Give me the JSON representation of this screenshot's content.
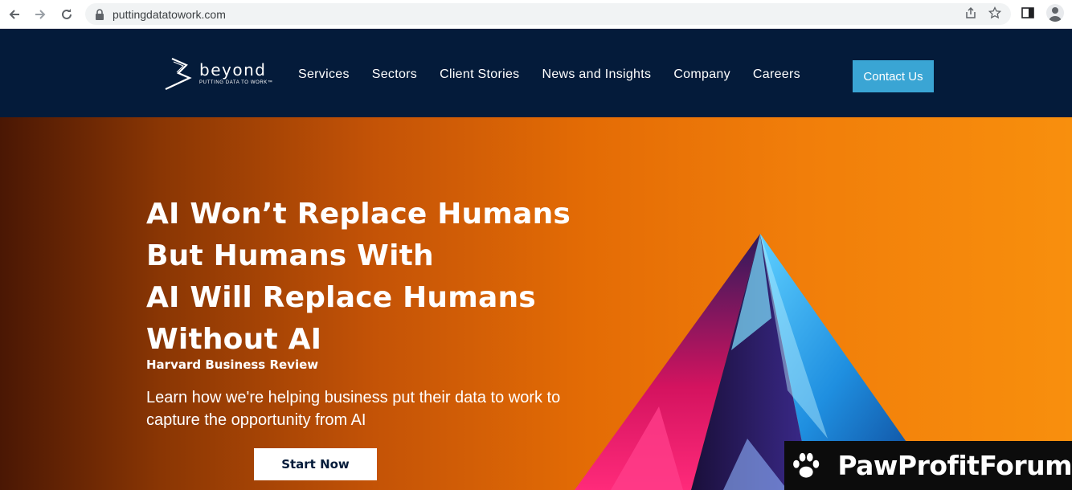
{
  "browser": {
    "url": "puttingdatatowork.com",
    "icons": [
      "back-arrow-icon",
      "forward-arrow-icon",
      "reload-icon",
      "lock-icon",
      "share-icon",
      "star-icon",
      "side-panel-icon",
      "profile-icon"
    ]
  },
  "header": {
    "logo_word": "beyond",
    "logo_tagline": "PUTTING DATA TO WORK™",
    "nav": [
      "Services",
      "Sectors",
      "Client Stories",
      "News and Insights",
      "Company",
      "Careers"
    ],
    "contact_label": "Contact Us",
    "bg_color": "#041b3a",
    "accent_color": "#3aa5d4"
  },
  "hero": {
    "title_lines": [
      "AI Won’t Replace Humans",
      "But Humans With",
      "AI Will Replace Humans",
      "Without AI"
    ],
    "source": "Harvard Business Review",
    "subtitle": "Learn how we're helping business put their data to work to capture the opportunity from AI",
    "cta_label": "Start Now"
  },
  "watermark": {
    "text": "PawProfitForum"
  }
}
